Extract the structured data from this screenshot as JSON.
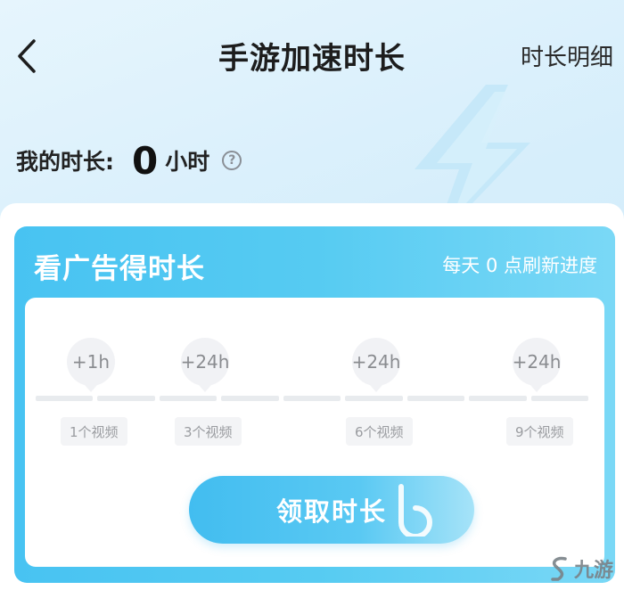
{
  "header": {
    "title": "手游加速时长",
    "detail_link": "时长明细"
  },
  "my_duration": {
    "label": "我的时长:",
    "value": "0",
    "unit": "小时"
  },
  "card": {
    "title": "看广告得时长",
    "refresh_note": "每天 0 点刷新进度",
    "milestones": [
      {
        "reward": "+1h",
        "videos": "1个视频"
      },
      {
        "reward": "+24h",
        "videos": "3个视频"
      },
      {
        "reward": "+24h",
        "videos": "6个视频"
      },
      {
        "reward": "+24h",
        "videos": "9个视频"
      }
    ],
    "claim_button": "领取时长"
  },
  "watermark": {
    "text": "九游"
  },
  "colors": {
    "accent": "#48c3f2",
    "page_bg": "#d6eefb",
    "muted": "#9a9ca0"
  }
}
